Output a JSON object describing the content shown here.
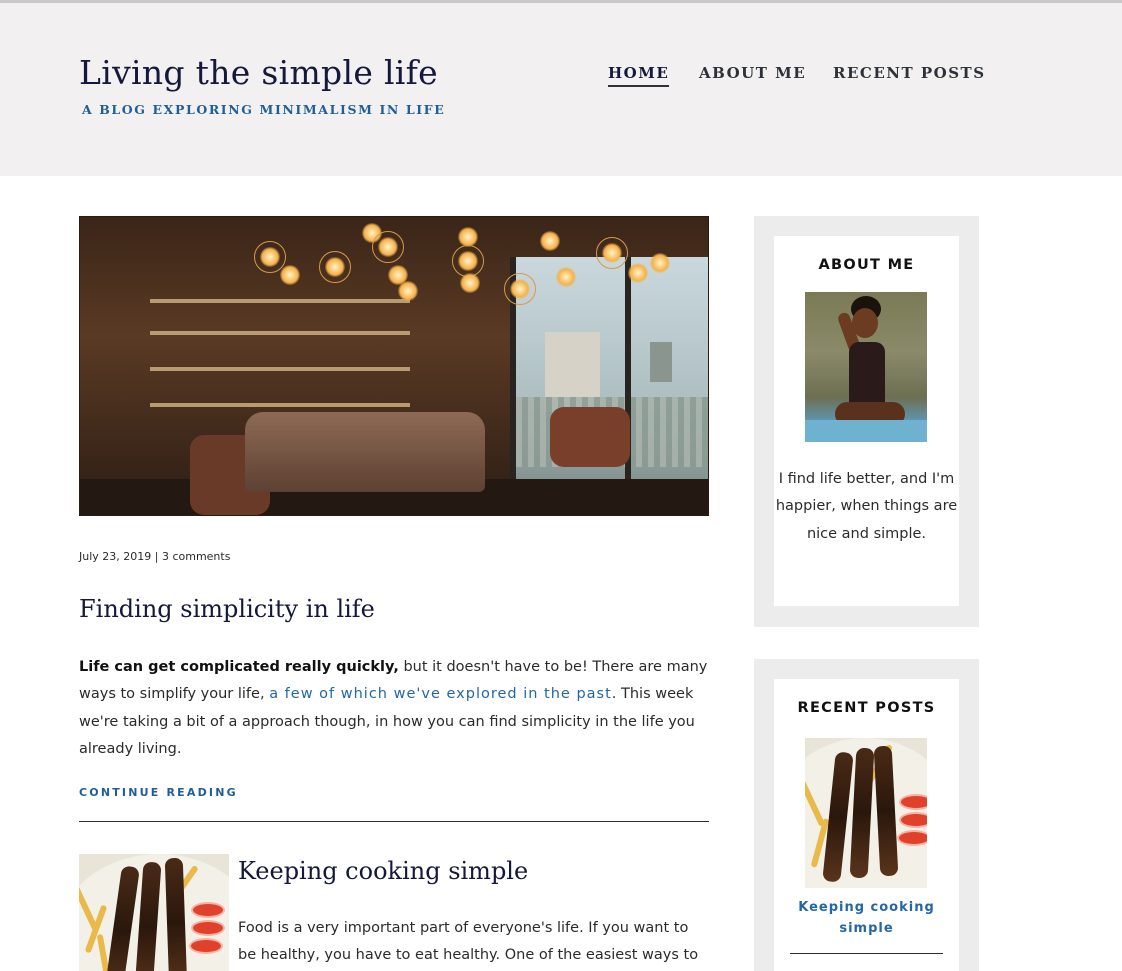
{
  "header": {
    "title": "Living the simple life",
    "tagline": "A BLOG EXPLORING MINIMALISM IN LIFE",
    "nav": [
      {
        "label": "HOME",
        "active": true
      },
      {
        "label": "ABOUT ME"
      },
      {
        "label": "RECENT POSTS"
      }
    ]
  },
  "featured_post": {
    "meta": "July 23, 2019 | 3 comments",
    "title": "Finding simplicity in life",
    "excerpt_bold": "Life can get complicated really quickly,",
    "excerpt_part1": " but it doesn't have to be! There are many ways to simplify your life, ",
    "excerpt_link": "a few of which we've explored in the past",
    "excerpt_part2": ". This week we're taking a bit of a approach though, in how you can find simplicity in the life you already living.",
    "continue_label": "CONTINUE READING"
  },
  "second_post": {
    "title": "Keeping cooking simple",
    "excerpt": "Food is a very important part of everyone's life. If you want to be healthy, you have to eat healthy. One of the easiest ways to do"
  },
  "sidebar": {
    "about": {
      "title": "ABOUT ME",
      "text": "I find life better, and I'm happier, when things are nice and simple."
    },
    "recent_posts": {
      "title": "RECENT POSTS",
      "items": [
        {
          "label": "Keeping cooking simple"
        }
      ]
    }
  },
  "colors": {
    "header_bg": "#f2f0f0",
    "title": "#14183a",
    "accent_blue": "#1f5e99",
    "widget_bg": "#ececec"
  }
}
